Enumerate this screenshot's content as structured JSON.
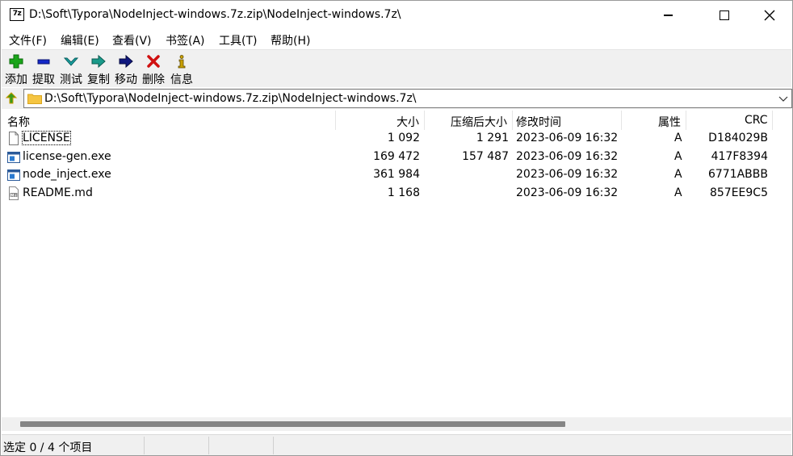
{
  "window": {
    "title": "D:\\Soft\\Typora\\NodeInject-windows.7z.zip\\NodeInject-windows.7z\\",
    "app_icon_text": "7z"
  },
  "menu": [
    "文件(F)",
    "编辑(E)",
    "查看(V)",
    "书签(A)",
    "工具(T)",
    "帮助(H)"
  ],
  "toolbar": [
    {
      "label": "添加",
      "icon": "add-icon",
      "color": "#1aa51a"
    },
    {
      "label": "提取",
      "icon": "extract-icon",
      "color": "#1428c8"
    },
    {
      "label": "测试",
      "icon": "test-icon",
      "color": "#1aa5a5"
    },
    {
      "label": "复制",
      "icon": "copy-icon",
      "color": "#1a9a8a"
    },
    {
      "label": "移动",
      "icon": "move-icon",
      "color": "#101880"
    },
    {
      "label": "删除",
      "icon": "delete-icon",
      "color": "#d01010"
    },
    {
      "label": "信息",
      "icon": "info-icon",
      "color": "#c8a000"
    }
  ],
  "address": {
    "path": "D:\\Soft\\Typora\\NodeInject-windows.7z.zip\\NodeInject-windows.7z\\"
  },
  "columns": [
    "名称",
    "大小",
    "压缩后大小",
    "修改时间",
    "属性",
    "CRC"
  ],
  "files": [
    {
      "name": "LICENSE",
      "size": "1 092",
      "packed": "1 291",
      "modified": "2023-06-09 16:32",
      "attr": "A",
      "crc": "D184029B",
      "icon": "text-file-icon"
    },
    {
      "name": "license-gen.exe",
      "size": "169 472",
      "packed": "157 487",
      "modified": "2023-06-09 16:32",
      "attr": "A",
      "crc": "417F8394",
      "icon": "exe-file-icon"
    },
    {
      "name": "node_inject.exe",
      "size": "361 984",
      "packed": "",
      "modified": "2023-06-09 16:32",
      "attr": "A",
      "crc": "6771ABBB",
      "icon": "exe-file-icon"
    },
    {
      "name": "README.md",
      "size": "1 168",
      "packed": "",
      "modified": "2023-06-09 16:32",
      "attr": "A",
      "crc": "857EE9C5",
      "icon": "markdown-file-icon"
    }
  ],
  "status": {
    "text": "选定 0 / 4 个项目"
  }
}
